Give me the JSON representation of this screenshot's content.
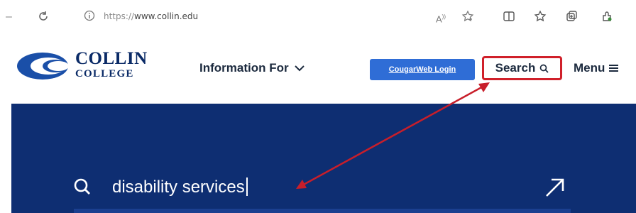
{
  "browser": {
    "url_prefix": "https://",
    "url_domain": "www.collin.edu",
    "icons": [
      "back-icon",
      "refresh-icon",
      "info-icon",
      "read-aloud-icon",
      "favorite-icon",
      "split-screen-icon",
      "favorites-bar-icon",
      "collections-icon",
      "extensions-icon"
    ]
  },
  "header": {
    "logo_line1": "COLLIN",
    "logo_line2": "COLLEGE",
    "information_for_label": "Information For",
    "cougarweb_label": "CougarWeb Login",
    "search_label": "Search",
    "menu_label": "Menu"
  },
  "search": {
    "query": "disability services"
  },
  "colors": {
    "navy": "#0e2e72",
    "brand_blue": "#2f6dd6",
    "highlight_red": "#d0202a",
    "logo_blue": "#1a4fa8"
  }
}
